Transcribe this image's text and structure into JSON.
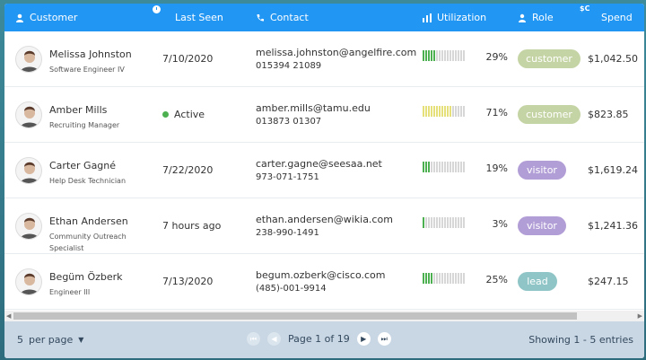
{
  "header": {
    "columns": [
      {
        "key": "customer",
        "label": "Customer",
        "icon": "user-icon"
      },
      {
        "key": "last_seen",
        "label": "Last Seen",
        "icon": "clock-icon"
      },
      {
        "key": "contact",
        "label": "Contact",
        "icon": "phone-icon"
      },
      {
        "key": "utilization",
        "label": "Utilization",
        "icon": "bar-chart-icon"
      },
      {
        "key": "role",
        "label": "Role",
        "icon": "user-group-icon"
      },
      {
        "key": "spend",
        "label": "Spend",
        "icon": "dollar-icon"
      }
    ],
    "dollar_badge": "$C"
  },
  "rows": [
    {
      "name": "Melissa Johnston",
      "title": "Software Engineer IV",
      "last_seen": "7/10/2020",
      "active": false,
      "email": "melissa.johnston@angelfire.com",
      "phone": "015394 21089",
      "utilization": 29,
      "util_color": "#4caf50",
      "role": "customer",
      "role_color": "#c5d4a4",
      "spend": "$1,042.50"
    },
    {
      "name": "Amber Mills",
      "title": "Recruiting Manager",
      "last_seen": "Active",
      "active": true,
      "email": "amber.mills@tamu.edu",
      "phone": "013873 01307",
      "utilization": 71,
      "util_color": "#e6e07a",
      "role": "customer",
      "role_color": "#c5d4a4",
      "spend": "$823.85"
    },
    {
      "name": "Carter Gagné",
      "title": "Help Desk Technician",
      "last_seen": "7/22/2020",
      "active": false,
      "email": "carter.gagne@seesaa.net",
      "phone": "973-071-1751",
      "utilization": 19,
      "util_color": "#4caf50",
      "role": "visitor",
      "role_color": "#b29ed6",
      "spend": "$1,619.24"
    },
    {
      "name": "Ethan Andersen",
      "title": "Community Outreach Specialist",
      "last_seen": "7 hours ago",
      "active": false,
      "email": "ethan.andersen@wikia.com",
      "phone": "238-990-1491",
      "utilization": 3,
      "util_color": "#4caf50",
      "role": "visitor",
      "role_color": "#b29ed6",
      "spend": "$1,241.36"
    },
    {
      "name": "Begüm Özberk",
      "title": "Engineer III",
      "last_seen": "7/13/2020",
      "active": false,
      "email": "begum.ozberk@cisco.com",
      "phone": "(485)-001-9914",
      "utilization": 25,
      "util_color": "#4caf50",
      "role": "lead",
      "role_color": "#8fc5c6",
      "spend": "$247.15"
    }
  ],
  "footer": {
    "page_size": "5",
    "page_size_suffix": "per page",
    "page_label": "Page 1 of 19",
    "showing": "Showing 1 - 5 entries"
  }
}
